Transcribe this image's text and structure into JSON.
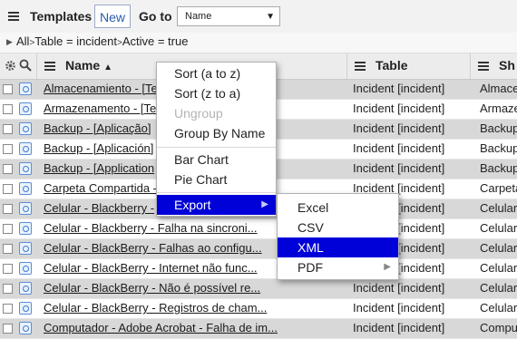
{
  "toolbar": {
    "title": "Templates",
    "new_label": "New",
    "goto_label": "Go to",
    "goto_selected": "Name"
  },
  "breadcrumb": {
    "items": [
      "All",
      "Table = incident",
      "Active = true"
    ]
  },
  "columns": {
    "name": "Name",
    "table": "Table",
    "sh": "Sh"
  },
  "rows": [
    {
      "name": "Almacenamiento - [Te",
      "table": "Incident [incident]",
      "sh": "Almace"
    },
    {
      "name": "Armazenamento - [Te",
      "table": "Incident [incident]",
      "sh": "Armaze"
    },
    {
      "name": "Backup - [Aplicação]",
      "table": "Incident [incident]",
      "sh": "Backup"
    },
    {
      "name": "Backup - [Aplicación]",
      "table": "Incident [incident]",
      "sh": "Backup"
    },
    {
      "name": "Backup - [Application",
      "table": "Incident [incident]",
      "sh": "Backup"
    },
    {
      "name": "Carpeta Compartida -",
      "table": "Incident [incident]",
      "sh": "Carpeta"
    },
    {
      "name": "Celular - Blackberry -",
      "table": "Incident [incident]",
      "sh": "Celular"
    },
    {
      "name": "Celular - Blackberry - Falha na sincroni...",
      "table": "Incident [incident]",
      "sh": "Celular"
    },
    {
      "name": "Celular - BlackBerry - Falhas ao configu...",
      "table": "Incident [incident]",
      "sh": "Celular"
    },
    {
      "name": "Celular - BlackBerry - Internet não func...",
      "table": "Incident [incident]",
      "sh": "Celular"
    },
    {
      "name": "Celular - BlackBerry - Não é possível re...",
      "table": "Incident [incident]",
      "sh": "Celular"
    },
    {
      "name": "Celular - BlackBerry - Registros de cham...",
      "table": "Incident [incident]",
      "sh": "Celular"
    },
    {
      "name": "Computador - Adobe Acrobat - Falha de im...",
      "table": "Incident [incident]",
      "sh": "Compu"
    }
  ],
  "context_menu": {
    "items": [
      "Sort (a to z)",
      "Sort (z to a)",
      "Ungroup",
      "Group By Name",
      "Bar Chart",
      "Pie Chart",
      "Export"
    ],
    "disabled": "Ungroup",
    "active": "Export"
  },
  "export_submenu": {
    "items": [
      "Excel",
      "CSV",
      "XML",
      "PDF"
    ],
    "active": "XML"
  },
  "colors": {
    "highlight": "#0000d8",
    "row_odd": "#d8d8d8",
    "link_blue": "#2a5db0"
  }
}
